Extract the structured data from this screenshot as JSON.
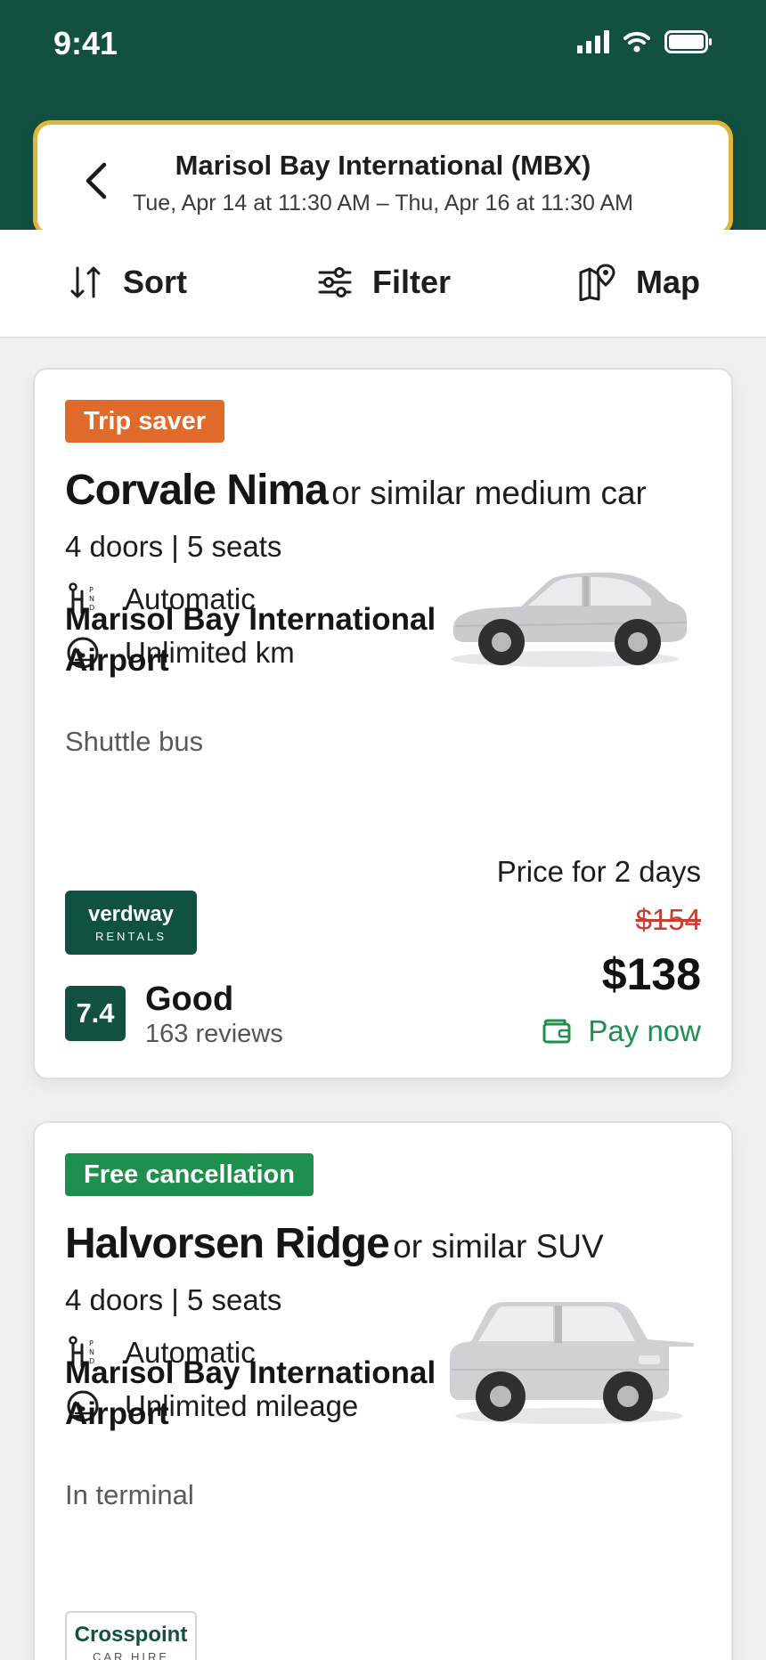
{
  "status_bar": {
    "time": "9:41"
  },
  "search": {
    "location": "Marisol Bay International (MBX)",
    "dates": "Tue, Apr 14 at 11:30 AM – Thu, Apr 16 at 11:30 AM"
  },
  "toolbar": {
    "sort_label": "Sort",
    "filter_label": "Filter",
    "map_label": "Map"
  },
  "colors": {
    "header_green": "#125141",
    "accent_yellow": "#e2b53a",
    "badge_orange": "#e06a2a",
    "badge_green": "#1f8f4d",
    "price_strike_red": "#c73d30"
  },
  "results": [
    {
      "badge": "Trip saver",
      "name": "Corvale Nima",
      "similar": "or similar medium car",
      "doors_seats": "4 doors | 5 seats",
      "transmission": "Automatic",
      "mileage": "Unlimited km",
      "pickup_location": "Marisol Bay International Airport",
      "pickup_type": "Shuttle bus",
      "vendor": {
        "name": "verdway",
        "sub": "RENTALS"
      },
      "rating": {
        "score": "7.4",
        "word": "Good",
        "reviews": "163 reviews"
      },
      "price": {
        "label": "Price for 2 days",
        "old": "$154",
        "current": "$138",
        "payment": "Pay now"
      }
    },
    {
      "badge": "Free cancellation",
      "name": "Halvorsen Ridge",
      "similar": "or similar SUV",
      "doors_seats": "4 doors | 5 seats",
      "transmission": "Automatic",
      "mileage": "Unlimited mileage",
      "pickup_location": "Marisol Bay International Airport",
      "pickup_type": "In terminal",
      "vendor": {
        "name": "Crosspoint",
        "sub": "CAR HIRE"
      }
    }
  ]
}
